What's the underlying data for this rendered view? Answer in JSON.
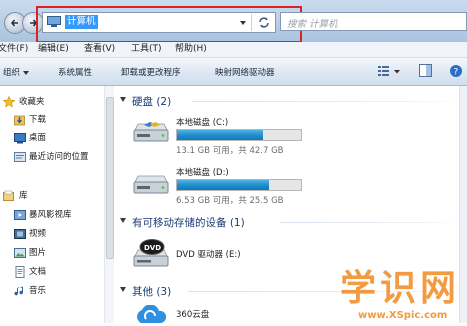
{
  "address": {
    "text": "计算机",
    "has_dropdown": true
  },
  "search": {
    "placeholder": "搜索 计算机"
  },
  "menu": [
    "文件(F)",
    "编辑(E)",
    "查看(V)",
    "工具(T)",
    "帮助(H)"
  ],
  "commands": [
    "组织",
    "系统属性",
    "卸载或更改程序",
    "映射网络驱动器"
  ],
  "nav": {
    "favorites_label": "收藏夹",
    "favorites": [
      "下载",
      "桌面",
      "最近访问的位置"
    ],
    "library_label": "库",
    "libraries": [
      "暴风影视库",
      "视频",
      "图片",
      "文档",
      "音乐"
    ]
  },
  "groups": {
    "hdd": "硬盘 (2)",
    "removable": "有可移动存储的设备 (1)",
    "other": "其他 (3)"
  },
  "drives": [
    {
      "name": "本地磁盘 (C:)",
      "info": "13.1 GB 可用，共 42.7 GB",
      "used_fraction": 0.69
    },
    {
      "name": "本地磁盘 (D:)",
      "info": "6.53 GB 可用，共 25.5 GB",
      "used_fraction": 0.74
    }
  ],
  "dvd": {
    "name": "DVD 驱动器 (E:)"
  },
  "other_items": [
    "360云盘"
  ],
  "watermark": {
    "text": "学识网",
    "url": "www.XSpic.com"
  },
  "colors": {
    "accent": "#3399ff",
    "highlight_box": "#e02121",
    "group_title": "#1b3a74",
    "drive_bar": "#1f8ccc"
  }
}
